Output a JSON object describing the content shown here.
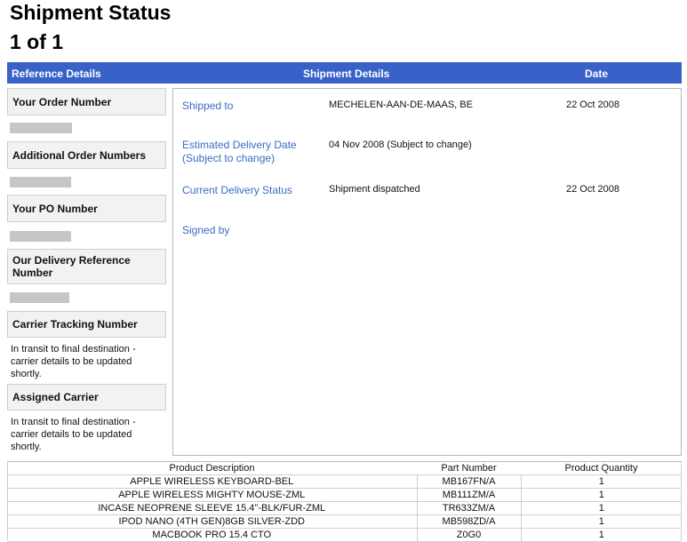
{
  "page": {
    "title": "Shipment Status",
    "page_count": "1 of 1"
  },
  "header": {
    "reference_details": "Reference Details",
    "shipment_details": "Shipment Details",
    "date": "Date"
  },
  "reference": {
    "order_number_label": "Your Order Number",
    "additional_numbers_label": "Additional Order Numbers",
    "po_number_label": "Your PO Number",
    "delivery_ref_label": "Our Delivery Reference Number",
    "tracking_label": "Carrier Tracking Number",
    "tracking_text": "In transit to final destination - carrier details to be updated shortly.",
    "carrier_label": "Assigned Carrier",
    "carrier_text": "In transit to final destination - carrier details to be updated shortly."
  },
  "shipment": {
    "shipped_to": {
      "label": "Shipped to",
      "value": "MECHELEN-AAN-DE-MAAS, BE",
      "date": "22 Oct 2008"
    },
    "estimated_delivery": {
      "label": "Estimated Delivery Date (Subject to change)",
      "value": "04 Nov 2008 (Subject to change)"
    },
    "delivery_status": {
      "label": "Current Delivery Status",
      "value": "Shipment dispatched",
      "date": "22 Oct 2008"
    },
    "signed_by": {
      "label": "Signed by"
    }
  },
  "products": {
    "headers": [
      "Product Description",
      "Part Number",
      "Product Quantity"
    ],
    "rows": [
      [
        "APPLE WIRELESS KEYBOARD-BEL",
        "MB167FN/A",
        "1"
      ],
      [
        "APPLE WIRELESS MIGHTY MOUSE-ZML",
        "MB111ZM/A",
        "1"
      ],
      [
        "INCASE NEOPRENE SLEEVE 15.4\"-BLK/FUR-ZML",
        "TR633ZM/A",
        "1"
      ],
      [
        "IPOD NANO (4TH GEN)8GB SILVER-ZDD",
        "MB598ZD/A",
        "1"
      ],
      [
        "MACBOOK PRO 15.4 CTO",
        "Z0G0",
        "1"
      ]
    ]
  }
}
